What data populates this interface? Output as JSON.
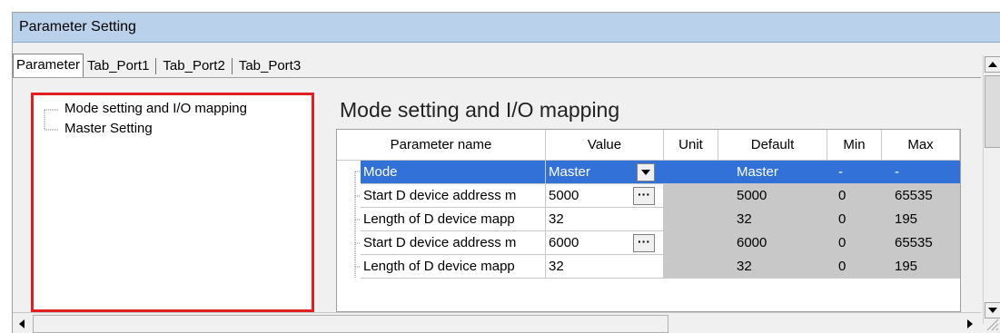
{
  "window": {
    "title": "Parameter Setting"
  },
  "tabs": [
    {
      "label": "Parameter",
      "active": true
    },
    {
      "label": "Tab_Port1",
      "active": false
    },
    {
      "label": "Tab_Port2",
      "active": false
    },
    {
      "label": "Tab_Port3",
      "active": false
    }
  ],
  "tree": {
    "items": [
      {
        "label": "Mode setting and I/O mapping"
      },
      {
        "label": "Master Setting"
      }
    ]
  },
  "section": {
    "title": "Mode setting and I/O mapping"
  },
  "grid": {
    "headers": [
      "Parameter name",
      "Value",
      "Unit",
      "Default",
      "Min",
      "Max"
    ],
    "rows": [
      {
        "name": "Mode",
        "value": "Master",
        "unit": "",
        "default": "Master",
        "min": "-",
        "max": "-",
        "control": "dropdown",
        "selected": true
      },
      {
        "name": "Start D device address m",
        "value": "5000",
        "unit": "",
        "default": "5000",
        "min": "0",
        "max": "65535",
        "control": "ellipsis",
        "selected": false
      },
      {
        "name": "Length of D device mapp",
        "value": "32",
        "unit": "",
        "default": "32",
        "min": "0",
        "max": "195",
        "control": "none",
        "selected": false
      },
      {
        "name": "Start D device address m",
        "value": "6000",
        "unit": "",
        "default": "6000",
        "min": "0",
        "max": "65535",
        "control": "ellipsis",
        "selected": false
      },
      {
        "name": "Length of D device mapp",
        "value": "32",
        "unit": "",
        "default": "32",
        "min": "0",
        "max": "195",
        "control": "none",
        "selected": false
      }
    ]
  },
  "colors": {
    "titlebar": "#b9d1ea",
    "selection": "#3272d8",
    "highlight_border": "#e02020",
    "readonly_cell": "#c8c8c8"
  }
}
